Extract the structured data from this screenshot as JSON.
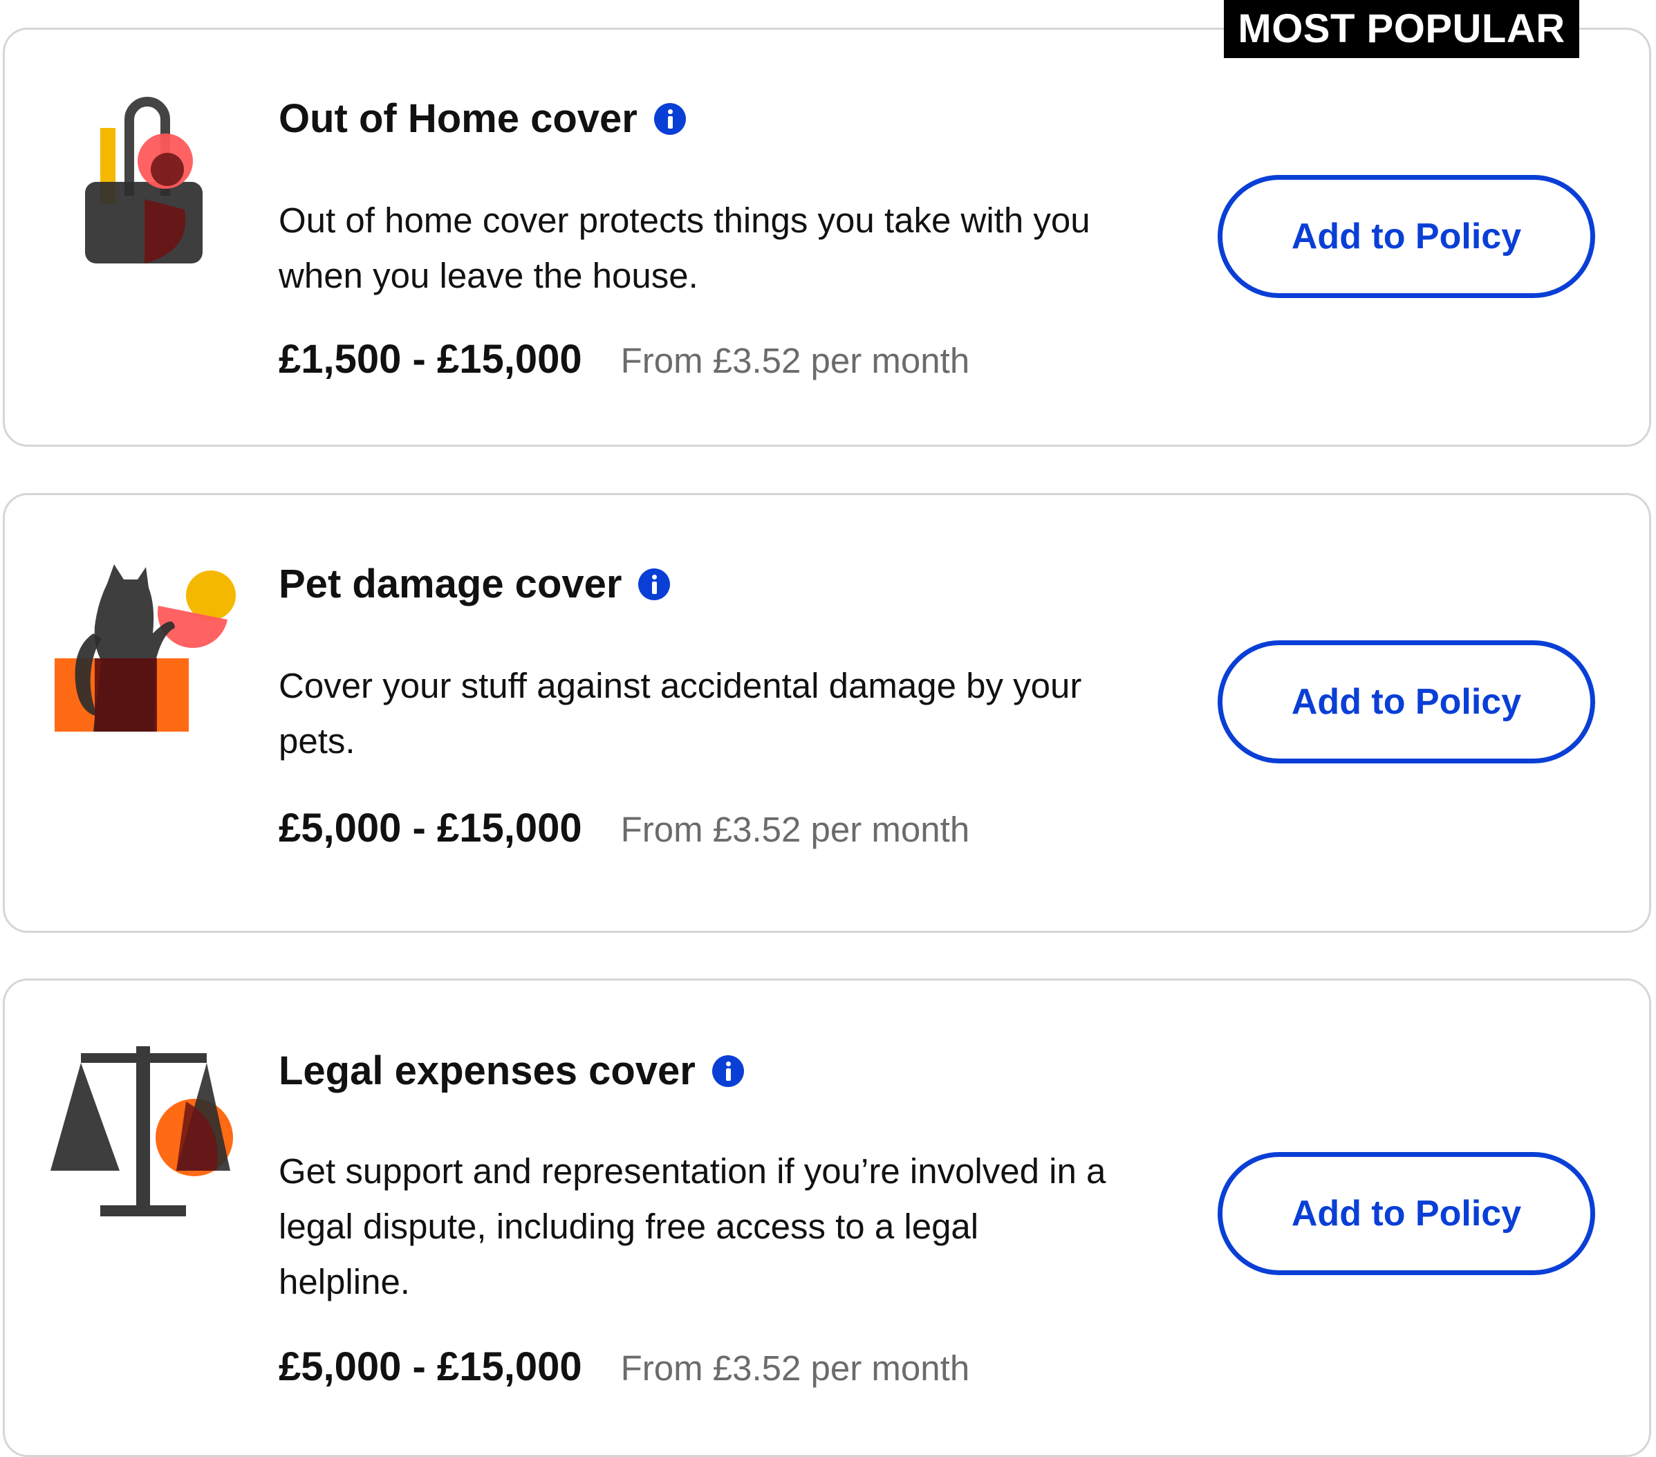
{
  "badge": {
    "label": "MOST POPULAR"
  },
  "cards": [
    {
      "title": "Out of Home cover",
      "description": "Out of home cover protects things you take with you when you leave the house.",
      "range": "£1,500 - £15,000",
      "price": "From £3.52 per month",
      "button": "Add to Policy",
      "icon": "shopping-bag-illustration"
    },
    {
      "title": "Pet damage cover",
      "description": "Cover your stuff against accidental damage by your pets.",
      "range": "£5,000 - £15,000",
      "price": "From £3.52 per month",
      "button": "Add to Policy",
      "icon": "cat-illustration"
    },
    {
      "title": "Legal expenses cover",
      "description": "Get support and representation if you’re involved in a legal dispute, including free access to a legal helpline.",
      "range": "£5,000 - £15,000",
      "price": "From £3.52 per month",
      "button": "Add to Policy",
      "icon": "scales-illustration"
    }
  ],
  "colors": {
    "accent_blue": "#0a3fd6",
    "badge_black": "#000000",
    "muted_text": "#6b6b6b",
    "card_border": "#d6d6d6",
    "illustration_yellow": "#f5b800",
    "illustration_red": "#ff5a5a",
    "illustration_orange": "#ff6a14",
    "illustration_dark": "#3a3a3a"
  }
}
